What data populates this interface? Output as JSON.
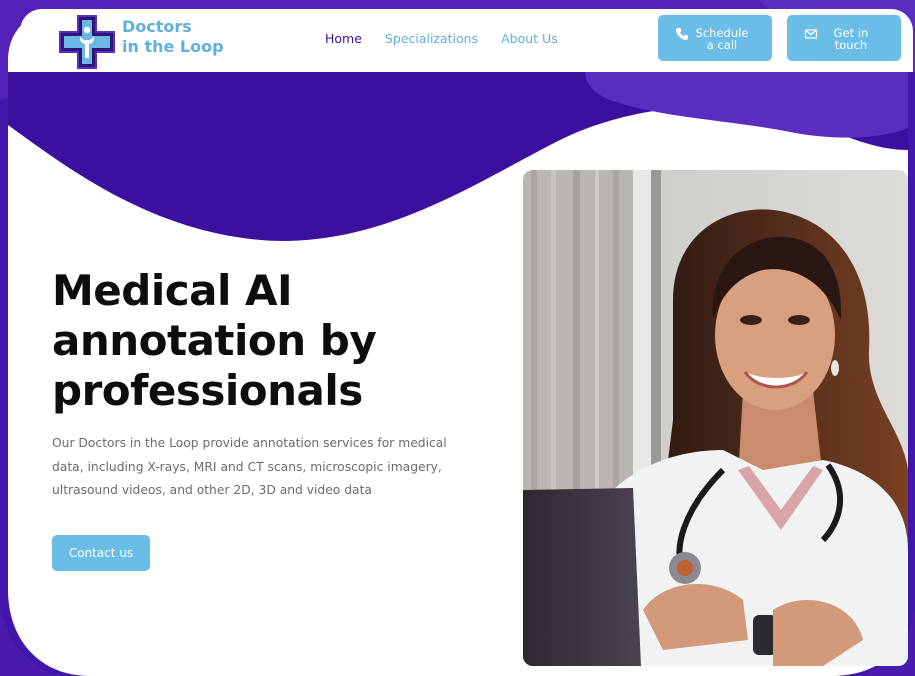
{
  "brand": {
    "name_line1": "Doctors",
    "name_line2": "in the Loop"
  },
  "nav": [
    {
      "label": "Home",
      "active": true
    },
    {
      "label": "Specializations",
      "active": false
    },
    {
      "label": "About Us",
      "active": false
    }
  ],
  "header_buttons": {
    "call": {
      "line1": "Schedule",
      "line2": "a call",
      "icon": "phone-icon"
    },
    "touch": {
      "line1": "Get in",
      "line2": "touch",
      "icon": "mail-icon"
    }
  },
  "hero": {
    "headline_line1": "Medical AI",
    "headline_line2": "annotation by",
    "headline_line3": "professionals",
    "description": "Our Doctors in the Loop provide annotation services for medical data, including X-rays, MRI and CT scans, microscopic imagery, ultrasound videos, and other 2D, 3D and video data",
    "cta_label": "Contact us"
  },
  "colors": {
    "deep_purple": "#3d0f9e",
    "bg_purple": "#4b1bb0",
    "accent_blue": "#69bde6",
    "nav_active": "#3b1592"
  }
}
